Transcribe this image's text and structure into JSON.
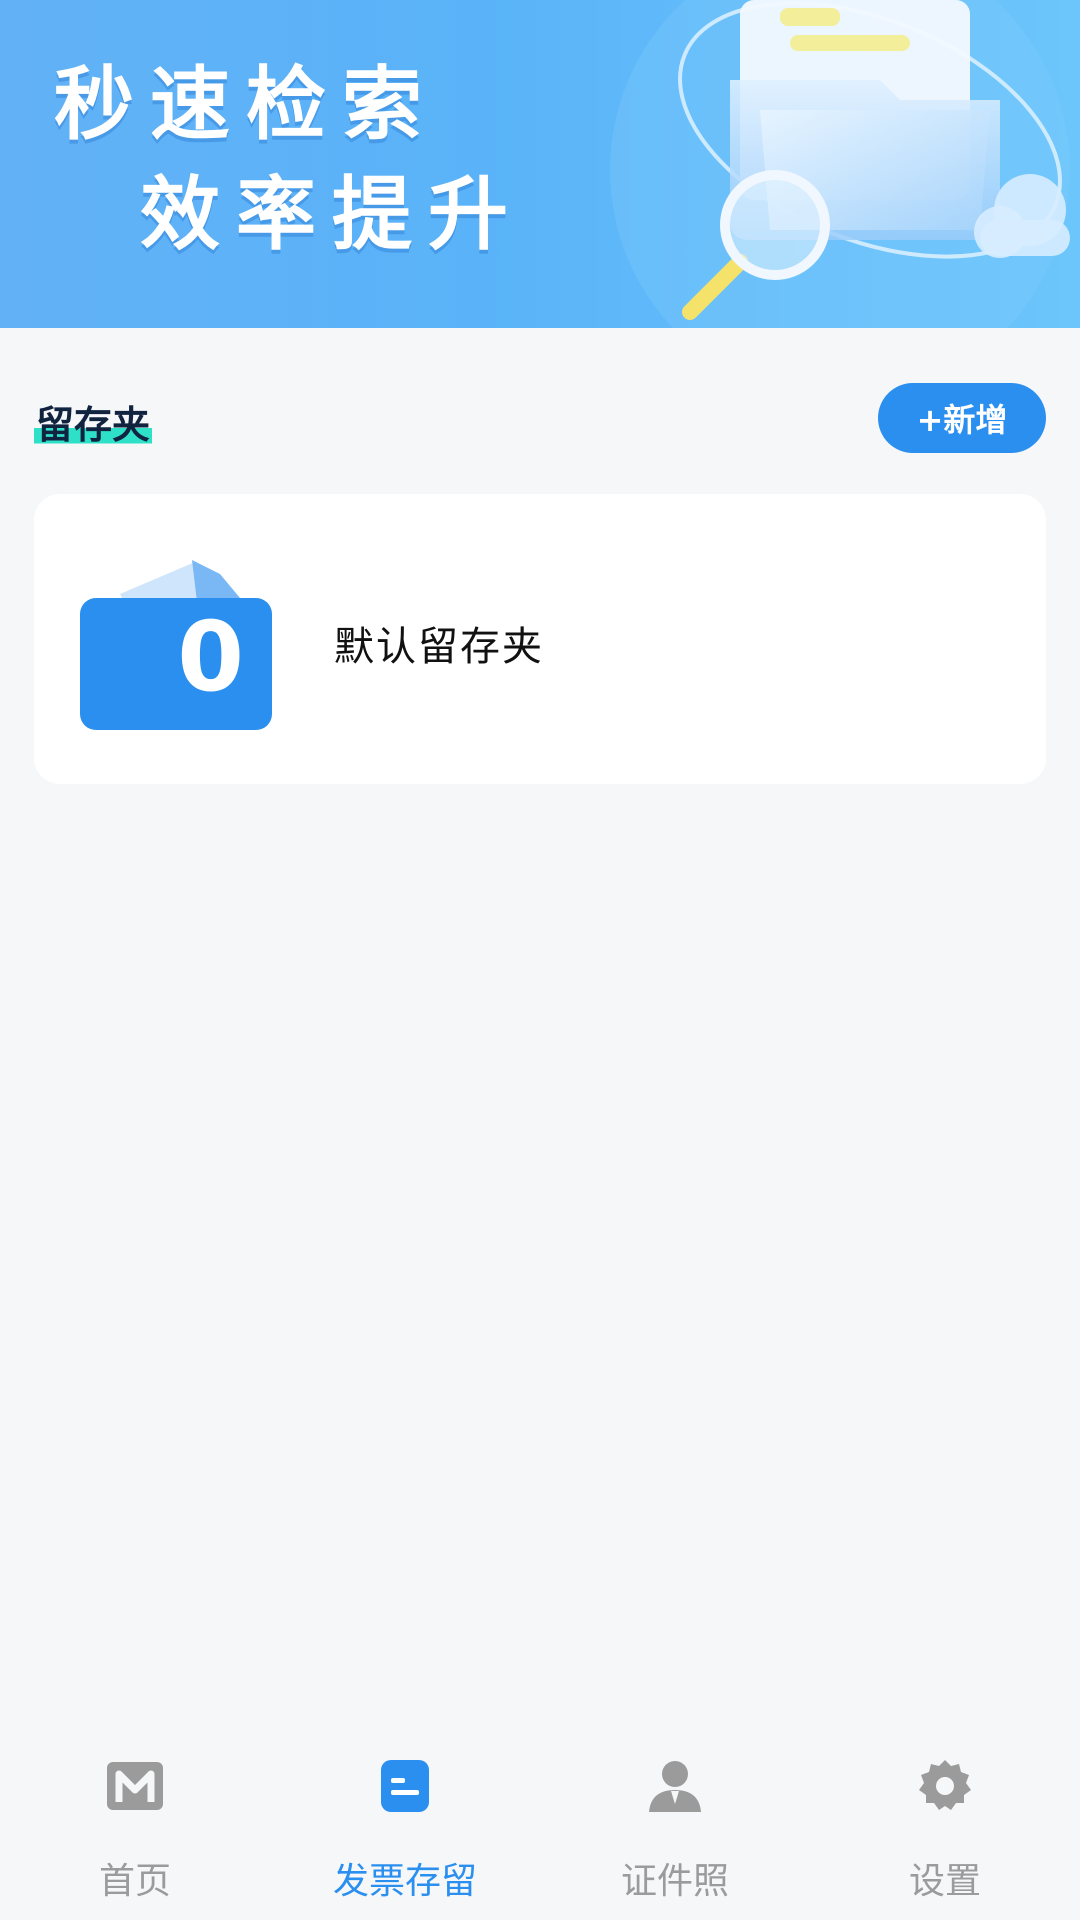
{
  "banner": {
    "line1": "秒速检索",
    "line2": "效率提升"
  },
  "section": {
    "title": "留存夹",
    "add_label": "+新增"
  },
  "folders": [
    {
      "name": "默认留存夹",
      "count": "0"
    }
  ],
  "nav": {
    "items": [
      {
        "label": "首页",
        "icon": "home-m-icon",
        "active": false
      },
      {
        "label": "发票存留",
        "icon": "invoice-icon",
        "active": true
      },
      {
        "label": "证件照",
        "icon": "person-icon",
        "active": false
      },
      {
        "label": "设置",
        "icon": "gear-icon",
        "active": false
      }
    ]
  },
  "colors": {
    "accent": "#2b8ff0",
    "nav_inactive": "#9b9b9b",
    "banner_blue": "#5ab3f8",
    "title_highlight": "#2ee0c8"
  }
}
